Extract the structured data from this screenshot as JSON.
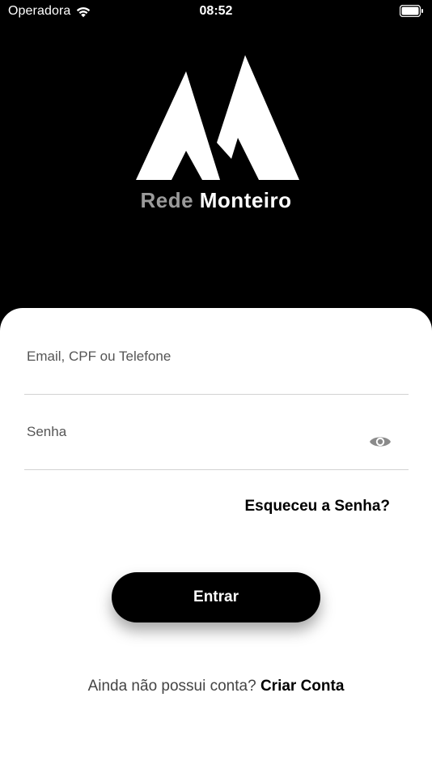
{
  "status_bar": {
    "carrier": "Operadora",
    "time": "08:52"
  },
  "logo": {
    "icon": "mountain-logo-icon",
    "brand_part_1": "Rede",
    "brand_part_2": "Monteiro"
  },
  "login_form": {
    "login_field": {
      "placeholder": "Email, CPF ou Telefone",
      "value": ""
    },
    "password_field": {
      "placeholder": "Senha",
      "value": "",
      "toggle_icon": "eye-icon"
    },
    "forgot_password_label": "Esqueceu a Senha?",
    "submit_label": "Entrar"
  },
  "signup": {
    "prompt": "Ainda não possui conta?",
    "link_label": "Criar Conta"
  },
  "colors": {
    "background": "#000000",
    "card": "#ffffff",
    "accent": "#000000",
    "brand_grey": "#9a9a9a",
    "divider": "#d2d2d2"
  }
}
